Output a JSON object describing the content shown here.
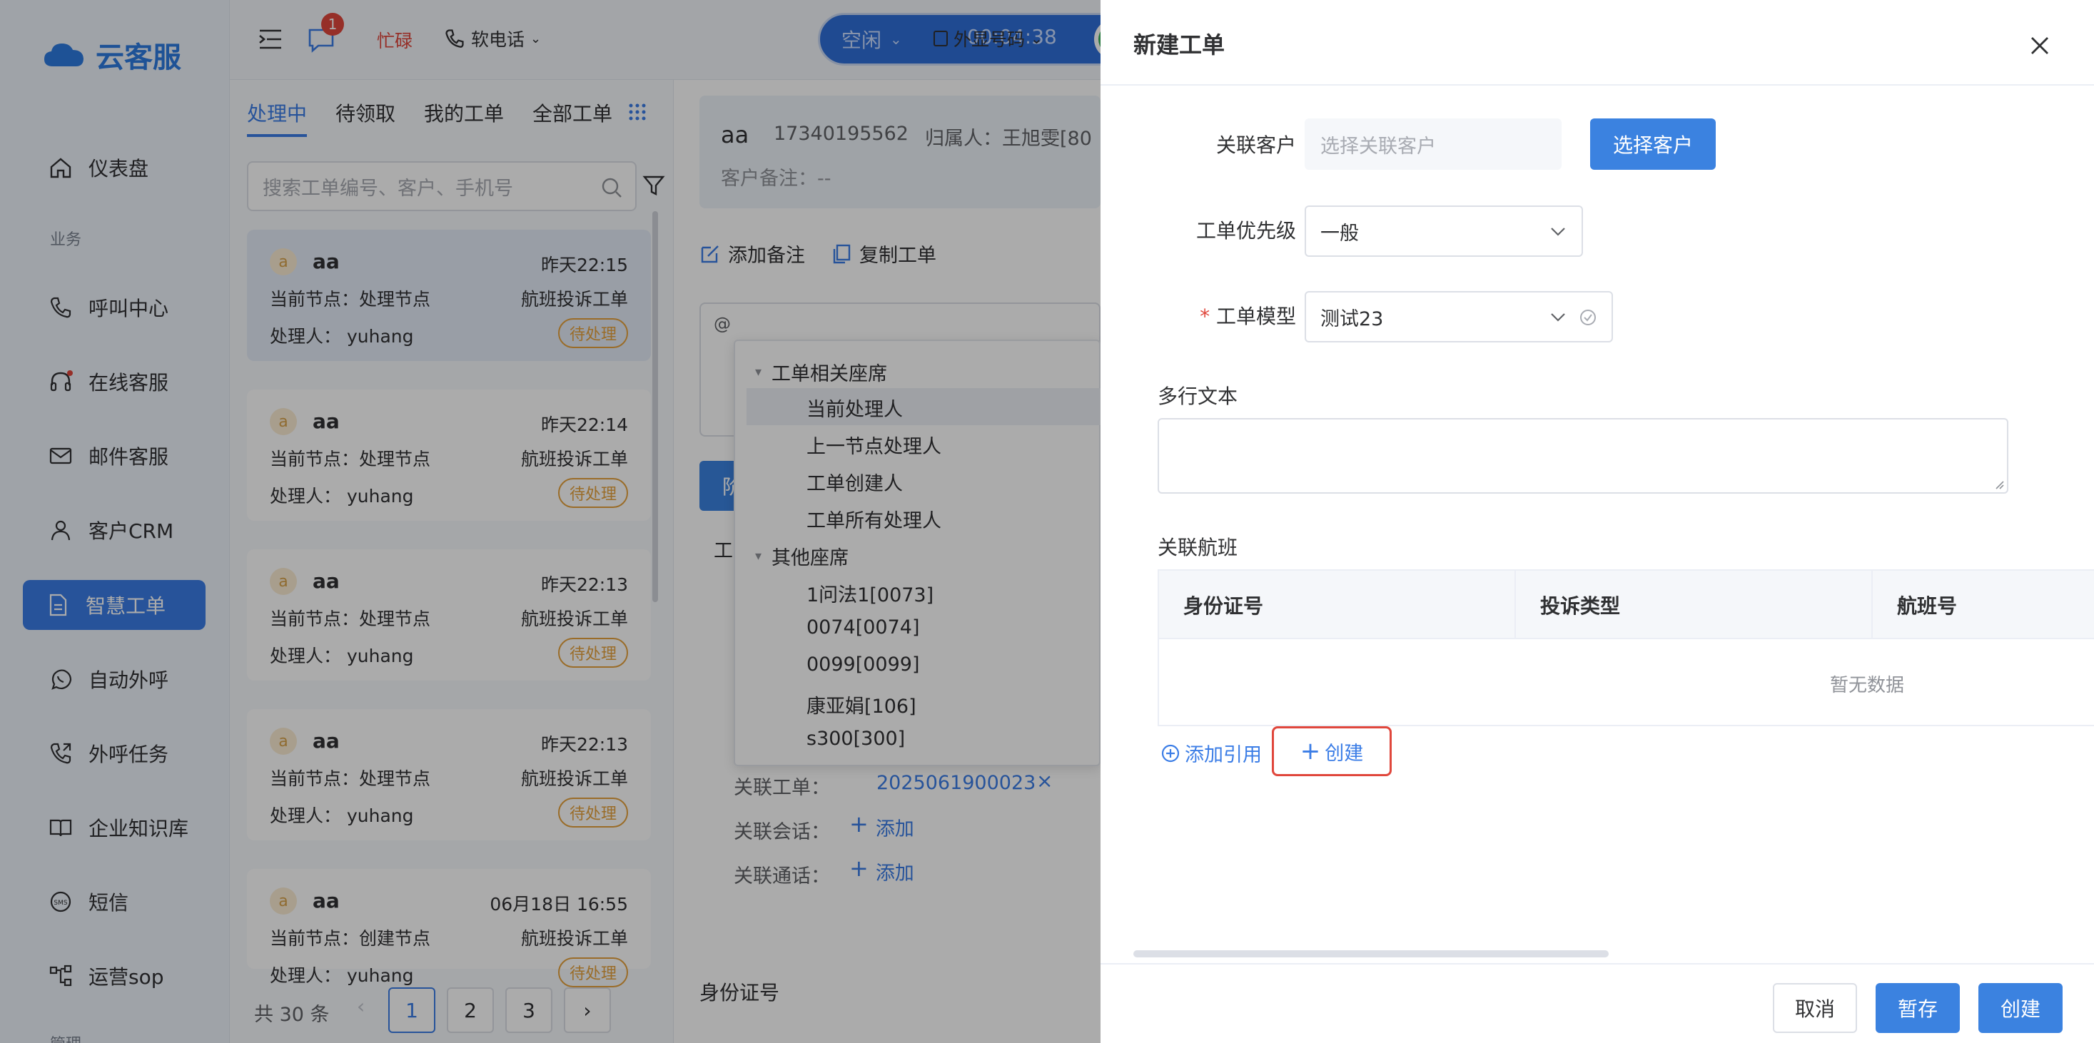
{
  "app": {
    "logo": "云客服"
  },
  "sidebar": {
    "items": [
      {
        "label": "仪表盘"
      },
      {
        "label": "呼叫中心"
      },
      {
        "label": "在线客服"
      },
      {
        "label": "邮件客服"
      },
      {
        "label": "客户CRM"
      },
      {
        "label": "智慧工单"
      },
      {
        "label": "自动外呼"
      },
      {
        "label": "外呼任务"
      },
      {
        "label": "企业知识库"
      },
      {
        "label": "短信"
      },
      {
        "label": "运营sop"
      }
    ],
    "section": "业务",
    "section2": "管理"
  },
  "topbar": {
    "msg_badge": "1",
    "busy": "忙碌",
    "phone": "软电话",
    "status": "空闲",
    "timer": "00:04:38",
    "outbound": "外显号码"
  },
  "tabs": [
    "处理中",
    "待领取",
    "我的工单",
    "全部工单"
  ],
  "search": {
    "placeholder": "搜索工单编号、客户、手机号"
  },
  "tickets": [
    {
      "avatar": "a",
      "name": "aa",
      "time": "昨天22:15",
      "node": "当前节点：处理节点",
      "type": "航班投诉工单",
      "handler_label": "处理人：",
      "handler": "yuhang",
      "status": "待处理"
    },
    {
      "avatar": "a",
      "name": "aa",
      "time": "昨天22:14",
      "node": "当前节点：处理节点",
      "type": "航班投诉工单",
      "handler_label": "处理人：",
      "handler": "yuhang",
      "status": "待处理"
    },
    {
      "avatar": "a",
      "name": "aa",
      "time": "昨天22:13",
      "node": "当前节点：处理节点",
      "type": "航班投诉工单",
      "handler_label": "处理人：",
      "handler": "yuhang",
      "status": "待处理"
    },
    {
      "avatar": "a",
      "name": "aa",
      "time": "昨天22:13",
      "node": "当前节点：处理节点",
      "type": "航班投诉工单",
      "handler_label": "处理人：",
      "handler": "yuhang",
      "status": "待处理"
    },
    {
      "avatar": "a",
      "name": "aa",
      "time": "06月18日 16:55",
      "node": "当前节点：创建节点",
      "type": "航班投诉工单",
      "handler_label": "处理人：",
      "handler": "yuhang",
      "status": "待处理"
    }
  ],
  "pagination": {
    "total": "共 30 条",
    "pages": [
      "1",
      "2",
      "3"
    ]
  },
  "detail": {
    "name": "aa",
    "phone": "17340195562",
    "owner": "归属人：王旭雯[80",
    "remark": "客户备注：--",
    "add_note": "添加备注",
    "copy_ticket": "复制工单",
    "at": "@",
    "dropdown": {
      "group1": "工单相关座席",
      "g1_items": [
        "当前处理人",
        "上一节点处理人",
        "工单创建人",
        "工单所有处理人"
      ],
      "group2": "其他座席",
      "g2_items": [
        "1问法1[0073]",
        "0074[0074]",
        "0099[0099]",
        "康亚娟[106]",
        "s300[300]"
      ]
    },
    "related_ticket_label": "关联工单：",
    "related_ticket_value": "2025061900023",
    "related_session_label": "关联会话：",
    "related_call_label": "关联通话：",
    "add": "添加",
    "idcard": "身份证号",
    "trunc1": "阶",
    "trunc2": "工"
  },
  "drawer": {
    "title": "新建工单",
    "customer_label": "关联客户",
    "customer_placeholder": "选择关联客户",
    "select_customer_btn": "选择客户",
    "priority_label": "工单优先级",
    "priority_value": "一般",
    "model_label": "工单模型",
    "model_value": "测试23",
    "required_mark": "*",
    "multiline_label": "多行文本",
    "flight_label": "关联航班",
    "table": {
      "columns": [
        "身份证号",
        "投诉类型",
        "航班号"
      ],
      "empty": "暂无数据"
    },
    "add_ref": "添加引用",
    "create_link": "创建",
    "cancel": "取消",
    "save": "暂存",
    "create": "创建"
  },
  "colors": {
    "primary": "#3b82e0",
    "warning": "#e6a23c",
    "highlight": "#e0473c"
  }
}
